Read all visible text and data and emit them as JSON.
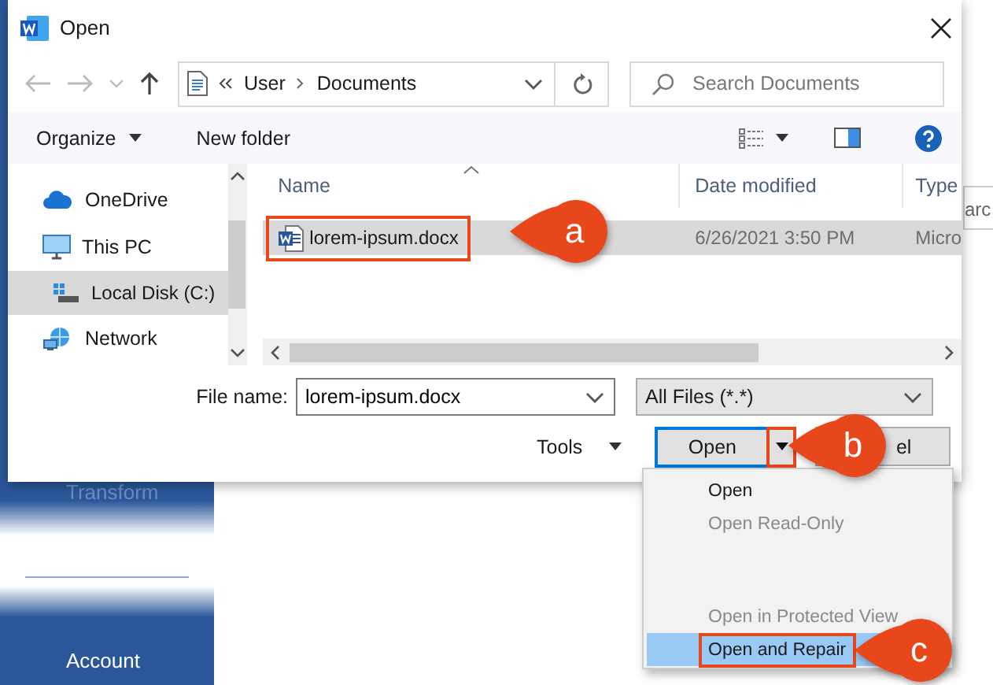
{
  "backstage": {
    "items": [
      {
        "label": "Transform",
        "disabled": true
      },
      {
        "label": "Account",
        "disabled": false
      }
    ]
  },
  "background_text": "arc",
  "dialog": {
    "title": "Open",
    "path": [
      "User",
      "Documents"
    ],
    "search": {
      "placeholder": "Search Documents"
    },
    "toolbar": {
      "organize": "Organize",
      "new_folder": "New folder"
    },
    "nav": [
      {
        "label": "OneDrive",
        "kind": "cloud",
        "selected": false
      },
      {
        "label": "This PC",
        "kind": "computer",
        "selected": false,
        "children": [
          {
            "label": "Local Disk (C:)",
            "kind": "drive",
            "selected": true
          }
        ]
      },
      {
        "label": "Network",
        "kind": "network",
        "selected": false
      }
    ],
    "columns": [
      "Name",
      "Date modified",
      "Type"
    ],
    "files": [
      {
        "name": "lorem-ipsum.docx",
        "date": "6/26/2021 3:50 PM",
        "type": "Micro",
        "selected": true,
        "highlighted": true
      }
    ],
    "file_name": {
      "label": "File name:",
      "value": "lorem-ipsum.docx"
    },
    "filter": "All Files (*.*)",
    "tools": "Tools",
    "open_button": {
      "label": "Open",
      "arrow_highlighted": true
    },
    "cancel_button": "el"
  },
  "open_menu": [
    {
      "label": "Open",
      "disabled": false,
      "selected": false,
      "highlighted": false
    },
    {
      "label": "Open Read-Only",
      "disabled": true,
      "selected": false,
      "highlighted": false
    },
    {
      "label": "Open in Protected View",
      "disabled": true,
      "selected": false,
      "highlighted": false,
      "gap_before": true
    },
    {
      "label": "Open and Repair",
      "disabled": false,
      "selected": true,
      "highlighted": true
    }
  ],
  "callouts": [
    {
      "label": "a"
    },
    {
      "label": "b"
    },
    {
      "label": "c"
    }
  ]
}
